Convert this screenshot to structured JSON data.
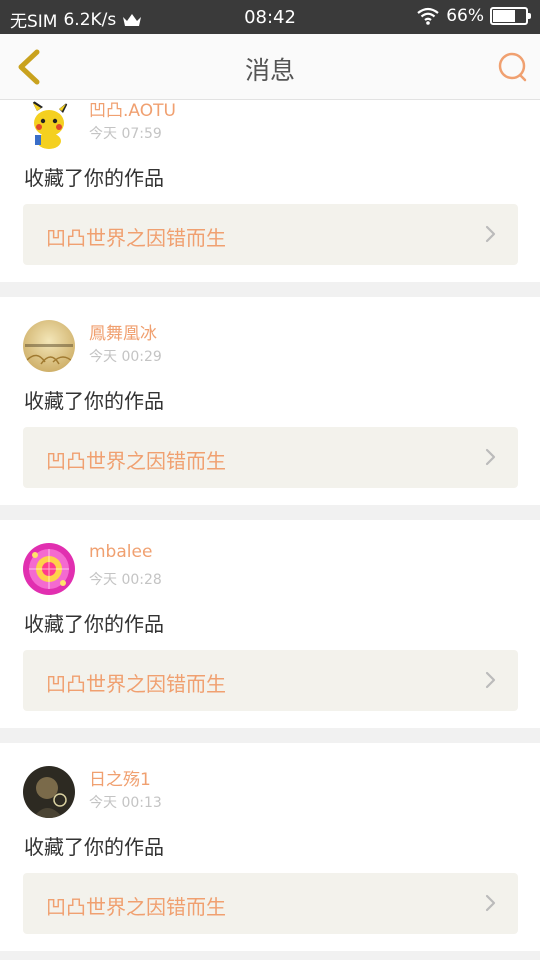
{
  "status": {
    "carrier": "无SIM",
    "speed": "6.2K/s",
    "time": "08:42",
    "battery": "66%",
    "battery_level": 0.66
  },
  "nav": {
    "title": "消息"
  },
  "colors": {
    "accent": "#f0a070",
    "back_arrow": "#c9a21e",
    "link_bg": "#f3f2ec"
  },
  "messages": [
    {
      "user": "凹凸.AOTU",
      "time": "今天 07:59",
      "action": "收藏了你的作品",
      "work": "凹凸世界之因错而生",
      "avatar": "pikachu-avatar"
    },
    {
      "user": "鳳舞凰冰",
      "time": "今天 00:29",
      "action": "收藏了你的作品",
      "work": "凹凸世界之因错而生",
      "avatar": "wheat-field-avatar"
    },
    {
      "user": "mbalee",
      "time": "今天 00:28",
      "action": "收藏了你的作品",
      "work": "凹凸世界之因错而生",
      "avatar": "pink-pattern-avatar"
    },
    {
      "user": "日之殇1",
      "time": "今天 00:13",
      "action": "收藏了你的作品",
      "work": "凹凸世界之因错而生",
      "avatar": "dark-portrait-avatar"
    }
  ]
}
